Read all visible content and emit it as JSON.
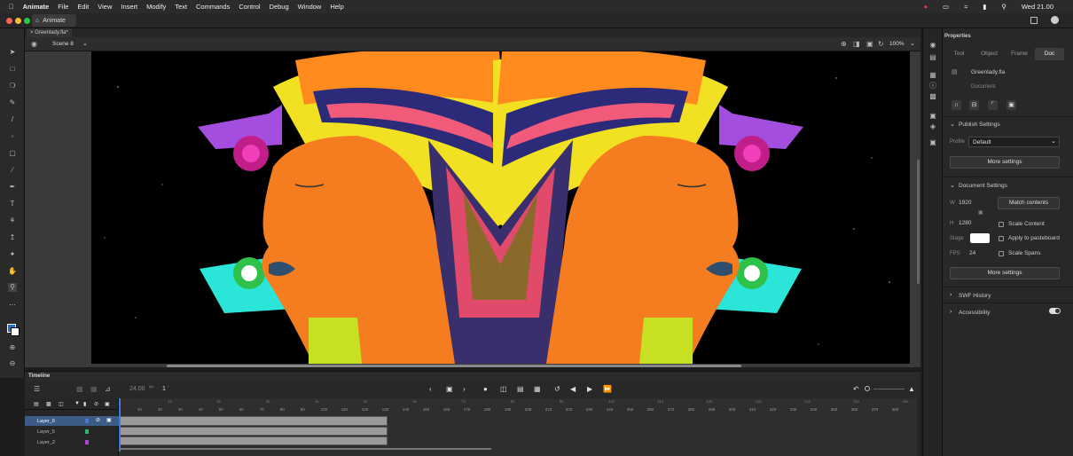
{
  "menubar": {
    "app": "Animate",
    "items": [
      "File",
      "Edit",
      "View",
      "Insert",
      "Modify",
      "Text",
      "Commands",
      "Control",
      "Debug",
      "Window",
      "Help"
    ],
    "clock": "Wed 21.00"
  },
  "app_tab": "Animate",
  "doc_tab": "Greenlady.fla*",
  "scene": "Scene 8",
  "zoom": "100%",
  "timeline": {
    "title": "Timeline",
    "fps": "24,00",
    "fps_unit": "fps",
    "frame": "1",
    "frame_unit": "f",
    "layers": [
      {
        "name": "Layer_6",
        "selected": true,
        "color": "#4a7bd1"
      },
      {
        "name": "Layer_5",
        "selected": false,
        "color": "#2bb673"
      },
      {
        "name": "Layer_2",
        "selected": false,
        "color": "#b340d9"
      }
    ],
    "frame_numbers": [
      "1",
      "10",
      "20",
      "30",
      "40",
      "50",
      "60",
      "70",
      "80",
      "90",
      "100",
      "110",
      "120",
      "130",
      "140",
      "150",
      "160",
      "170",
      "180",
      "190",
      "200",
      "210",
      "220",
      "230",
      "240",
      "250",
      "260",
      "270",
      "280",
      "290",
      "300",
      "310",
      "320",
      "330",
      "340",
      "350",
      "360",
      "370",
      "380"
    ],
    "second_markers": [
      "1s",
      "2s",
      "3s",
      "4s",
      "5s",
      "6s",
      "7s",
      "8s",
      "9s",
      "10s",
      "11s",
      "12s",
      "13s",
      "14s",
      "15s",
      "16s"
    ],
    "filled_frames": 130
  },
  "properties": {
    "title": "Properties",
    "tabs": [
      "Tool",
      "Object",
      "Frame",
      "Doc"
    ],
    "active_tab": "Doc",
    "doc_name": "Greenlady.fla",
    "doc_type": "Document",
    "publish": {
      "header": "Publish Settings",
      "profile_label": "Profile",
      "profile_value": "Default",
      "more": "More settings"
    },
    "document": {
      "header": "Document Settings",
      "w_label": "W",
      "width": "1920",
      "h_label": "H",
      "height": "1280",
      "match": "Match contents",
      "scale_content": "Scale Content",
      "stage_label": "Stage",
      "apply_pasteboard": "Apply to pasteboard",
      "fps_label": "FPS",
      "fps": "24",
      "scale_spans": "Scale Spans",
      "more": "More settings"
    },
    "swf_history": "SWF History",
    "accessibility": "Accessibility"
  }
}
